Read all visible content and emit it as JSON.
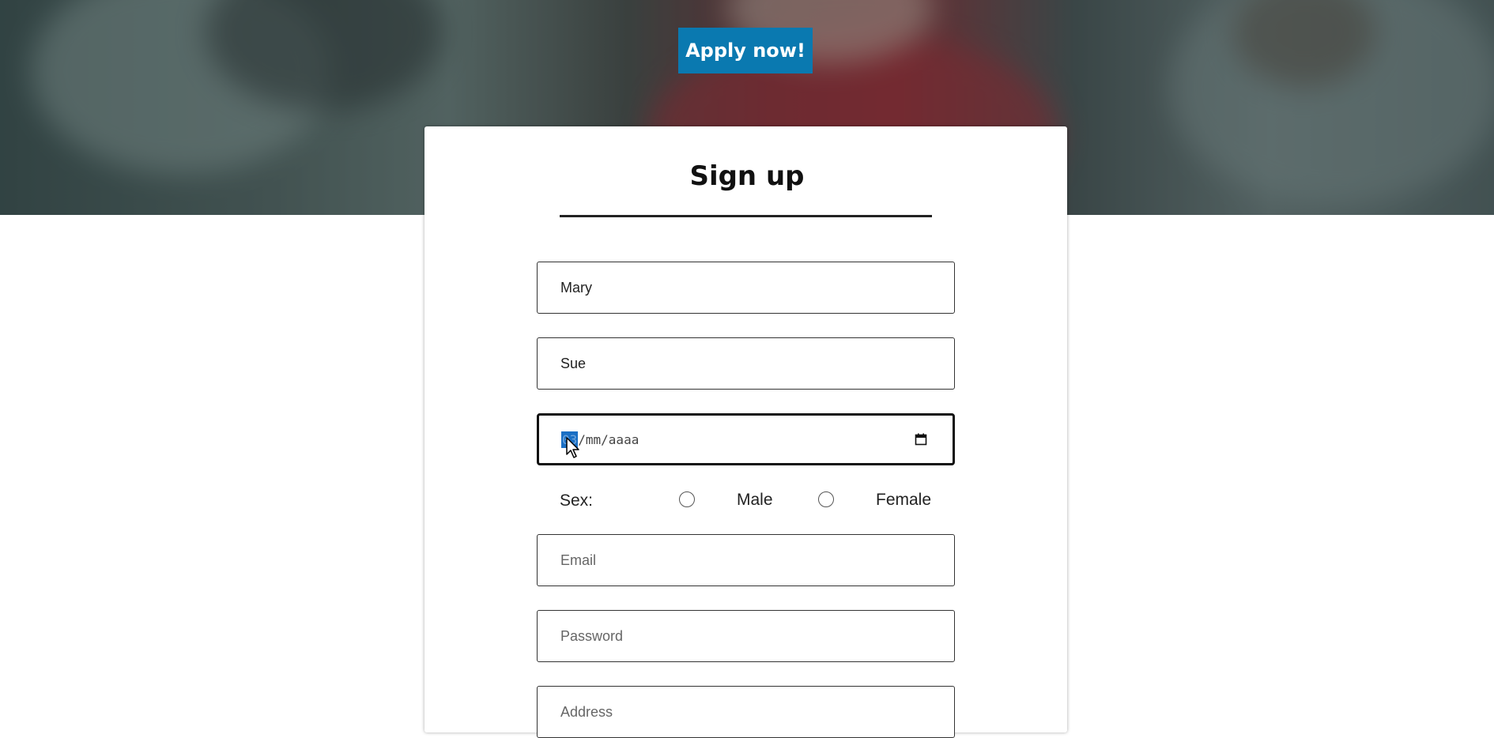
{
  "hero": {
    "apply_label": "Apply now!"
  },
  "form": {
    "title": "Sign up",
    "first_name_value": "Mary",
    "last_name_value": "Sue",
    "date": {
      "selected_segment": "03",
      "rest": "/mm/aaaa"
    },
    "sex_label": "Sex:",
    "sex_options": [
      "Male",
      "Female"
    ],
    "email_placeholder": "Email",
    "password_placeholder": "Password",
    "address_placeholder": "Address"
  },
  "colors": {
    "accent": "#0a79b0",
    "date_selection": "#1a6fc4"
  },
  "icons": {
    "date": "calendar-icon",
    "pointer": "mouse-cursor-icon"
  }
}
